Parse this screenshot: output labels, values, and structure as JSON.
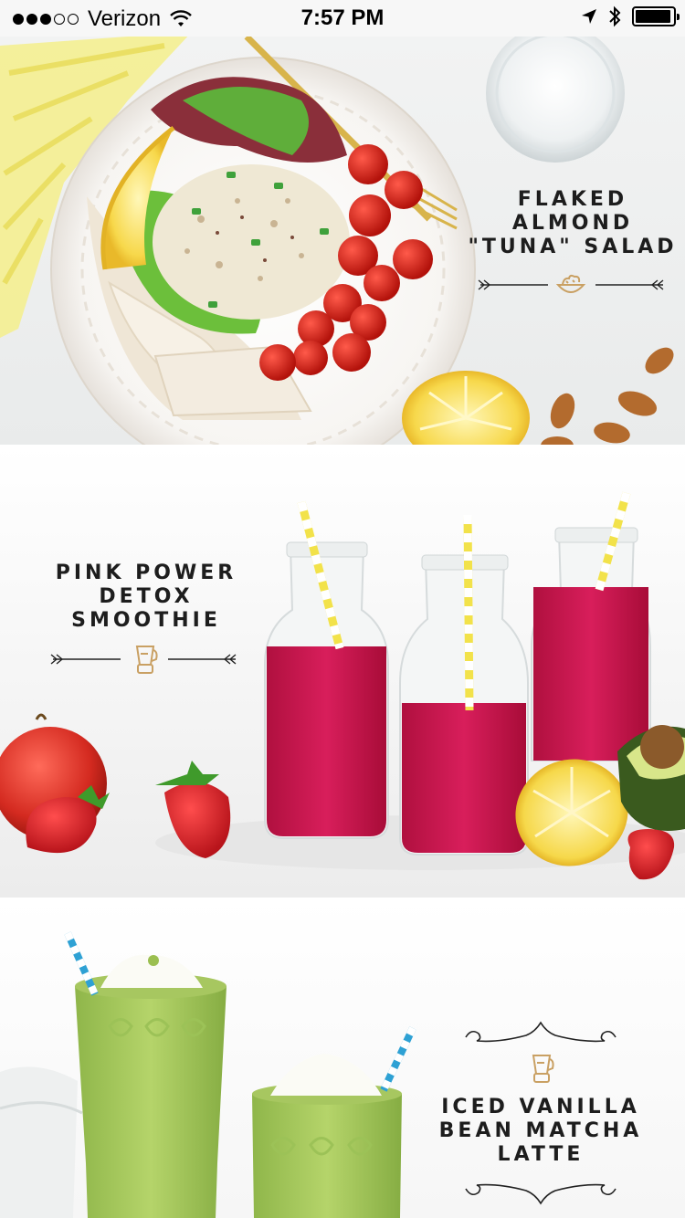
{
  "status_bar": {
    "carrier": "Verizon",
    "signal_bars_filled": 3,
    "signal_bars_total": 5,
    "time": "7:57 PM",
    "battery_level": 0.95,
    "icons": [
      "wifi-icon",
      "location-arrow-icon",
      "bluetooth-icon",
      "battery-icon"
    ]
  },
  "recipes": [
    {
      "title": "FLAKED\nALMOND\n\"TUNA\" SALAD",
      "icon": "salad-bowl-icon"
    },
    {
      "title": "PINK POWER\nDETOX\nSMOOTHIE",
      "icon": "blender-icon"
    },
    {
      "title": "ICED VANILLA\nBEAN MATCHA\nLATTE",
      "icon": "blender-icon"
    }
  ],
  "colors": {
    "accent_gold": "#c9a063",
    "text_dark": "#1d1d1d"
  }
}
